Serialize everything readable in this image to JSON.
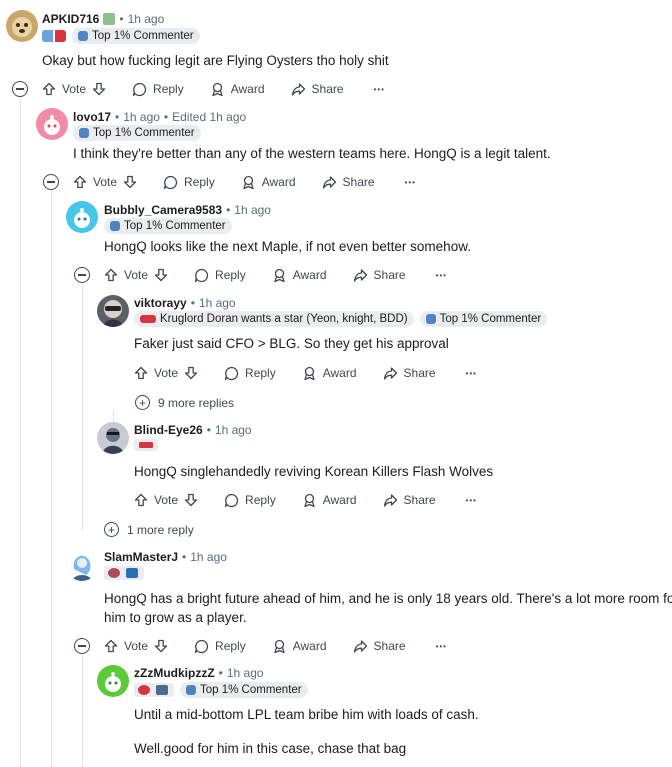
{
  "action_labels": {
    "vote": "Vote",
    "reply": "Reply",
    "award": "Award",
    "share": "Share",
    "overflow": "•••"
  },
  "comments": [
    {
      "user": "APKID716",
      "time": "1h ago",
      "edited": "",
      "flairs": [
        "Top 1% Commenter"
      ],
      "text": [
        "Okay but how fucking legit are Flying Oysters tho holy shit"
      ]
    },
    {
      "user": "lovo17",
      "time": "1h ago",
      "edited": "Edited 1h ago",
      "flairs": [
        "Top 1% Commenter"
      ],
      "text": [
        "I think they're better than any of the western teams here. HongQ is a legit talent."
      ]
    },
    {
      "user": "Bubbly_Camera9583",
      "time": "1h ago",
      "edited": "",
      "flairs": [
        "Top 1% Commenter"
      ],
      "text": [
        "HongQ looks like the next Maple, if not even better somehow."
      ]
    },
    {
      "user": "viktorayy",
      "time": "1h ago",
      "edited": "",
      "flairs": [
        "Kruglord Doran wants a star (Yeon, knight, BDD)",
        "Top 1% Commenter"
      ],
      "text": [
        "Faker just said CFO > BLG. So they get his approval"
      ]
    },
    {
      "user": "Blind-Eye26",
      "time": "1h ago",
      "edited": "",
      "flairs": [],
      "text": [
        "HongQ singlehandedly reviving Korean Killers Flash Wolves"
      ]
    },
    {
      "user": "SlamMasterJ",
      "time": "1h ago",
      "edited": "",
      "flairs": [],
      "text": [
        "HongQ has a bright future ahead of him, and he is only 18 years old. There's a lot more room for",
        "him to grow as a player."
      ]
    },
    {
      "user": "zZzMudkipzzZ",
      "time": "1h ago",
      "edited": "",
      "flairs": [
        "Top 1% Commenter"
      ],
      "text": [
        "Until a mid-bottom LPL team bribe him with loads of cash.",
        "Well.good for him in this case, chase that bag"
      ]
    }
  ],
  "more_replies": [
    {
      "label": "9 more replies"
    },
    {
      "label": "1 more reply"
    }
  ]
}
